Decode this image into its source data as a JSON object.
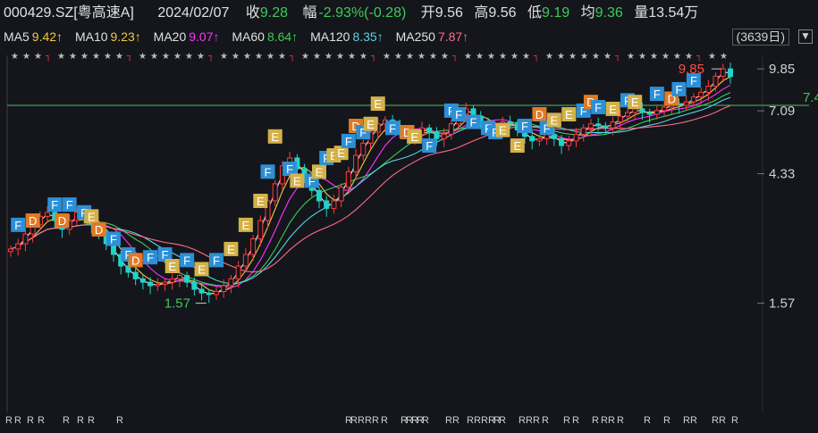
{
  "header": {
    "code_name": "000429.SZ[粤高速A]",
    "date": "2024/02/07",
    "close_label": "收",
    "close": "9.28",
    "change_label": "幅",
    "change": "-2.93%(-0.28)",
    "open_label": "开",
    "open": "9.56",
    "high_label": "高",
    "high": "9.56",
    "low_label": "低",
    "low": "9.19",
    "avg_label": "均",
    "avg": "9.36",
    "volume_label": "量",
    "volume": "13.54万"
  },
  "ma_row": {
    "ma5": "MA5",
    "ma5_val": "9.42↑",
    "ma10": "MA10",
    "ma10_val": "9.23↑",
    "ma20": "MA20",
    "ma20_val": "9.07↑",
    "ma60": "MA60",
    "ma60_val": "8.64↑",
    "ma120": "MA120",
    "ma120_val": "8.35↑",
    "ma250": "MA250",
    "ma250_val": "7.87↑",
    "days": "(3639日)",
    "settings_glyph": "▼"
  },
  "colors": {
    "ma5": "#e0e0e0",
    "ma10": "#f2c744",
    "ma20": "#ff33ff",
    "ma60": "#3ec95a",
    "ma120": "#5ad1e6",
    "ma250": "#ff6b8a",
    "up": "#ff3b3b",
    "down": "#21d3c7",
    "f_marker": "#2d8fd6",
    "e_marker": "#d4b14a",
    "d_marker": "#e07a25"
  },
  "chart_data": {
    "type": "candlestick",
    "y_axis_ticks": [
      "9.85",
      "7.09",
      "4.33",
      "1.57"
    ],
    "y_ticks_values": [
      9.85,
      7.09,
      4.33,
      1.57
    ],
    "ylim": [
      0.7,
      10.5
    ],
    "log_scale": true,
    "high_annotation": "9.85",
    "low_annotation": "1.57",
    "horizontal_line_label": "7.4",
    "horizontal_line_value": 7.4,
    "close_path": [
      2.4,
      2.5,
      2.7,
      2.9,
      3.1,
      3.2,
      3.0,
      2.8,
      3.0,
      3.2,
      3.1,
      2.9,
      2.7,
      2.5,
      2.3,
      2.1,
      2.0,
      1.9,
      1.85,
      1.8,
      1.82,
      1.85,
      1.9,
      1.95,
      1.85,
      1.75,
      1.7,
      1.68,
      1.72,
      1.8,
      1.9,
      2.1,
      2.3,
      2.6,
      3.0,
      3.5,
      4.0,
      4.6,
      4.9,
      4.5,
      4.2,
      3.8,
      3.5,
      3.3,
      3.5,
      3.9,
      4.4,
      5.0,
      5.5,
      6.0,
      6.4,
      6.6,
      6.3,
      6.0,
      5.8,
      5.9,
      6.2,
      6.0,
      5.7,
      5.9,
      6.4,
      6.9,
      7.2,
      6.8,
      6.4,
      6.2,
      6.3,
      6.5,
      6.4,
      6.1,
      5.8,
      5.6,
      5.7,
      5.9,
      5.7,
      5.4,
      5.6,
      5.9,
      6.2,
      6.4,
      6.3,
      6.2,
      6.5,
      6.8,
      7.0,
      7.2,
      7.0,
      6.9,
      7.1,
      7.3,
      7.5,
      7.4,
      7.6,
      7.9,
      8.2,
      8.6,
      9.3,
      9.85,
      9.28
    ],
    "moving_averages": [
      {
        "name": "MA5",
        "value": 9.42
      },
      {
        "name": "MA10",
        "value": 9.23
      },
      {
        "name": "MA20",
        "value": 9.07
      },
      {
        "name": "MA60",
        "value": 8.64
      },
      {
        "name": "MA120",
        "value": 8.35
      },
      {
        "name": "MA250",
        "value": 7.87
      }
    ],
    "markers": [
      {
        "t": "F",
        "i": 1,
        "v": 2.9
      },
      {
        "t": "D",
        "i": 3,
        "v": 3.0
      },
      {
        "t": "F",
        "i": 6,
        "v": 3.4
      },
      {
        "t": "D",
        "i": 7,
        "v": 3.0
      },
      {
        "t": "F",
        "i": 8,
        "v": 3.4
      },
      {
        "t": "F",
        "i": 10,
        "v": 3.2
      },
      {
        "t": "E",
        "i": 11,
        "v": 3.1
      },
      {
        "t": "D",
        "i": 12,
        "v": 2.8
      },
      {
        "t": "F",
        "i": 14,
        "v": 2.6
      },
      {
        "t": "F",
        "i": 16,
        "v": 2.3
      },
      {
        "t": "D",
        "i": 17,
        "v": 2.2
      },
      {
        "t": "F",
        "i": 19,
        "v": 2.25
      },
      {
        "t": "F",
        "i": 21,
        "v": 2.3
      },
      {
        "t": "E",
        "i": 22,
        "v": 2.1
      },
      {
        "t": "F",
        "i": 24,
        "v": 2.2
      },
      {
        "t": "E",
        "i": 26,
        "v": 2.05
      },
      {
        "t": "F",
        "i": 28,
        "v": 2.2
      },
      {
        "t": "E",
        "i": 30,
        "v": 2.4
      },
      {
        "t": "E",
        "i": 32,
        "v": 2.9
      },
      {
        "t": "E",
        "i": 34,
        "v": 3.5
      },
      {
        "t": "F",
        "i": 35,
        "v": 4.4
      },
      {
        "t": "E",
        "i": 36,
        "v": 5.8
      },
      {
        "t": "F",
        "i": 38,
        "v": 4.5
      },
      {
        "t": "E",
        "i": 39,
        "v": 4.1
      },
      {
        "t": "F",
        "i": 41,
        "v": 4.1
      },
      {
        "t": "E",
        "i": 42,
        "v": 4.4
      },
      {
        "t": "F",
        "i": 43,
        "v": 4.9
      },
      {
        "t": "E",
        "i": 44,
        "v": 5.0
      },
      {
        "t": "E",
        "i": 45,
        "v": 5.1
      },
      {
        "t": "F",
        "i": 46,
        "v": 5.6
      },
      {
        "t": "D",
        "i": 47,
        "v": 6.3
      },
      {
        "t": "F",
        "i": 48,
        "v": 6.0
      },
      {
        "t": "E",
        "i": 49,
        "v": 6.4
      },
      {
        "t": "E",
        "i": 50,
        "v": 7.5
      },
      {
        "t": "F",
        "i": 52,
        "v": 6.2
      },
      {
        "t": "D",
        "i": 54,
        "v": 6.0
      },
      {
        "t": "E",
        "i": 55,
        "v": 5.8
      },
      {
        "t": "F",
        "i": 57,
        "v": 5.4
      },
      {
        "t": "F",
        "i": 60,
        "v": 7.1
      },
      {
        "t": "F",
        "i": 61,
        "v": 6.9
      },
      {
        "t": "F",
        "i": 63,
        "v": 6.5
      },
      {
        "t": "F",
        "i": 65,
        "v": 6.2
      },
      {
        "t": "F",
        "i": 66,
        "v": 6.0
      },
      {
        "t": "E",
        "i": 67,
        "v": 6.1
      },
      {
        "t": "E",
        "i": 69,
        "v": 5.4
      },
      {
        "t": "F",
        "i": 70,
        "v": 6.3
      },
      {
        "t": "D",
        "i": 72,
        "v": 6.9
      },
      {
        "t": "F",
        "i": 73,
        "v": 6.2
      },
      {
        "t": "E",
        "i": 74,
        "v": 6.6
      },
      {
        "t": "E",
        "i": 76,
        "v": 6.9
      },
      {
        "t": "F",
        "i": 78,
        "v": 7.1
      },
      {
        "t": "D",
        "i": 79,
        "v": 7.6
      },
      {
        "t": "F",
        "i": 80,
        "v": 7.3
      },
      {
        "t": "E",
        "i": 82,
        "v": 7.2
      },
      {
        "t": "F",
        "i": 84,
        "v": 7.7
      },
      {
        "t": "E",
        "i": 85,
        "v": 7.6
      },
      {
        "t": "F",
        "i": 88,
        "v": 8.1
      },
      {
        "t": "D",
        "i": 90,
        "v": 7.8
      },
      {
        "t": "F",
        "i": 91,
        "v": 8.4
      },
      {
        "t": "F",
        "i": 93,
        "v": 9.0
      }
    ],
    "rows_top_glyph": "★",
    "rows_bottom_glyph": "R"
  }
}
